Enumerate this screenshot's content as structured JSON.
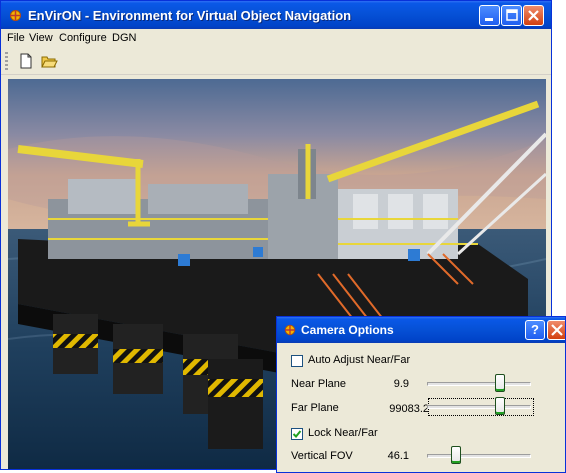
{
  "window": {
    "title": "EnVirON - Environment for Virtual Object Navigation"
  },
  "menu": {
    "items": [
      "File",
      "View",
      "Configure",
      "DGN"
    ]
  },
  "toolbar": {
    "icons": [
      "new-document-icon",
      "open-folder-icon"
    ]
  },
  "colors": {
    "title_blue": "#0651d7",
    "close_red": "#d2400f",
    "dialog_bg": "#ece9d8",
    "slider_accent": "#21a121"
  },
  "camera_dialog": {
    "title": "Camera Options",
    "help_button": "?",
    "auto_adjust": {
      "label": "Auto Adjust Near/Far",
      "checked": false
    },
    "near_plane": {
      "label": "Near Plane",
      "value": "9.9",
      "slider_fraction": 0.72
    },
    "far_plane": {
      "label": "Far Plane",
      "value": "99083.2",
      "slider_fraction": 0.72
    },
    "lock": {
      "label": "Lock Near/Far",
      "checked": true
    },
    "vertical_fov": {
      "label": "Vertical FOV",
      "value": "46.1",
      "slider_fraction": 0.26
    }
  }
}
